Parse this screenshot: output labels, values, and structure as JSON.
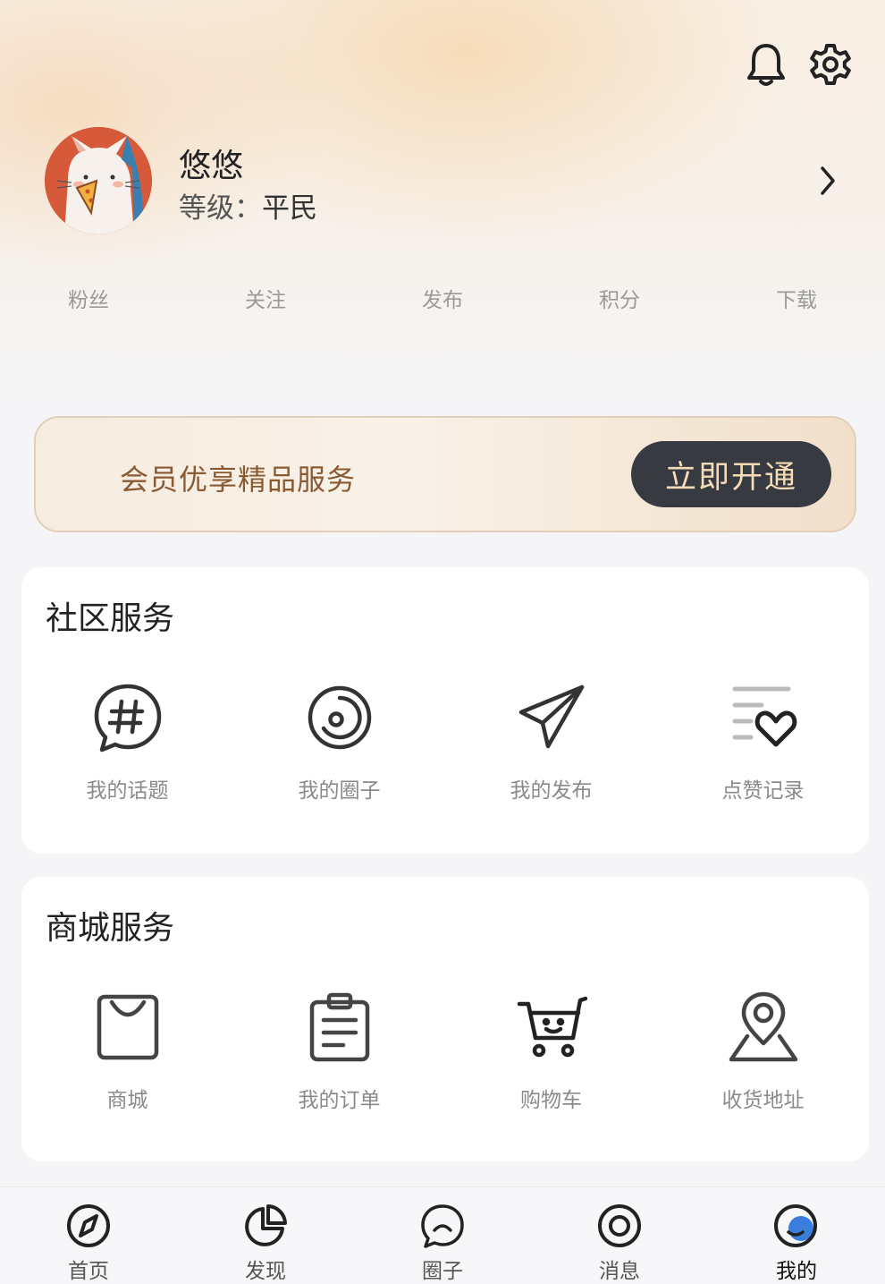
{
  "header": {
    "bell_icon": "bell-icon",
    "settings_icon": "gear-icon"
  },
  "profile": {
    "name": "悠悠",
    "level_label": "等级：",
    "level_value": "平民"
  },
  "stats": [
    {
      "label": "粉丝"
    },
    {
      "label": "关注"
    },
    {
      "label": "发布"
    },
    {
      "label": "积分"
    },
    {
      "label": "下载"
    }
  ],
  "vip": {
    "text": "会员优享精品服务",
    "button": "立即开通"
  },
  "community": {
    "title": "社区服务",
    "items": [
      {
        "label": "我的话题",
        "icon": "hashtag-bubble-icon"
      },
      {
        "label": "我的圈子",
        "icon": "circle-icon"
      },
      {
        "label": "我的发布",
        "icon": "paper-plane-icon"
      },
      {
        "label": "点赞记录",
        "icon": "heart-list-icon"
      }
    ]
  },
  "mall": {
    "title": "商城服务",
    "items": [
      {
        "label": "商城",
        "icon": "shopping-bag-icon"
      },
      {
        "label": "我的订单",
        "icon": "clipboard-icon"
      },
      {
        "label": "购物车",
        "icon": "cart-icon"
      },
      {
        "label": "收货地址",
        "icon": "location-pin-icon"
      }
    ]
  },
  "tabs": [
    {
      "label": "首页",
      "icon": "compass-icon"
    },
    {
      "label": "发现",
      "icon": "pie-chart-icon"
    },
    {
      "label": "圈子",
      "icon": "chat-bubble-icon"
    },
    {
      "label": "消息",
      "icon": "target-icon"
    },
    {
      "label": "我的",
      "icon": "profile-smile-icon",
      "active": true
    }
  ],
  "colors": {
    "accent": "#3b7ddd",
    "vip_text": "#8a5a32",
    "vip_button": "#373a40",
    "vip_button_text": "#f4dcb8"
  }
}
